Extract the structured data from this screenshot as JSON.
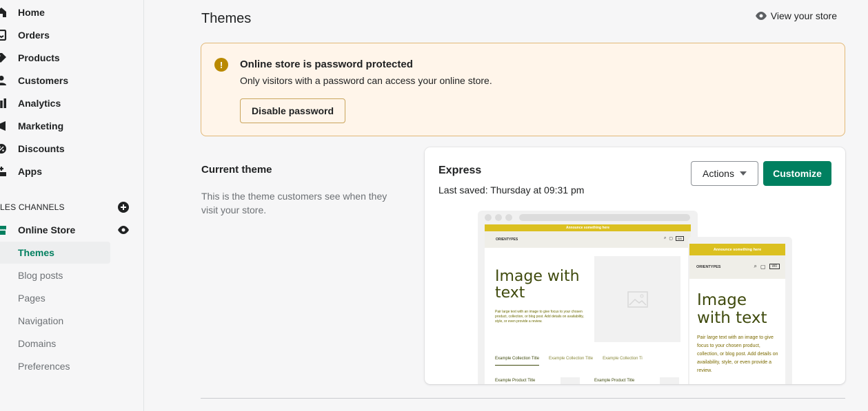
{
  "sidebar": {
    "items": [
      {
        "label": "Home",
        "icon": "home-icon"
      },
      {
        "label": "Orders",
        "icon": "orders-icon"
      },
      {
        "label": "Products",
        "icon": "tag-icon"
      },
      {
        "label": "Customers",
        "icon": "person-icon"
      },
      {
        "label": "Analytics",
        "icon": "bar-chart-icon"
      },
      {
        "label": "Marketing",
        "icon": "megaphone-icon"
      },
      {
        "label": "Discounts",
        "icon": "discount-icon"
      },
      {
        "label": "Apps",
        "icon": "apps-icon"
      }
    ],
    "channels_label": "LES CHANNELS",
    "online_store": {
      "label": "Online Store",
      "icon": "store-icon"
    },
    "sub_items": [
      {
        "label": "Themes",
        "active": true
      },
      {
        "label": "Blog posts"
      },
      {
        "label": "Pages"
      },
      {
        "label": "Navigation"
      },
      {
        "label": "Domains"
      },
      {
        "label": "Preferences"
      }
    ]
  },
  "header": {
    "title": "Themes",
    "view_store": "View your store"
  },
  "banner": {
    "title": "Online store is password protected",
    "text": "Only visitors with a password can access your online store.",
    "button": "Disable password"
  },
  "current_theme": {
    "title": "Current theme",
    "description": "This is the theme customers see when they visit your store."
  },
  "theme_card": {
    "name": "Express",
    "last_saved": "Last saved: Thursday at 09:31 pm",
    "actions_label": "Actions",
    "customize_label": "Customize"
  },
  "preview": {
    "announcement": "Announce something here",
    "logo": "ORIENTYPES",
    "heading": "Image with text",
    "copy": "Pair large text with an image to give focus to your chosen product, collection, or blog post. Add details on availability, style, or even provide a review.",
    "tabs": [
      "Example Collection Title",
      "Example Collection Title",
      "Example Collection Ti"
    ],
    "product_title": "Example Product Title",
    "cart_badge": "W0"
  },
  "colors": {
    "primary": "#008060",
    "warning_bg": "#fff5ea",
    "warning_border": "#e1b878",
    "active_nav": "#007f5f",
    "preview_accent": "#dbc020"
  }
}
